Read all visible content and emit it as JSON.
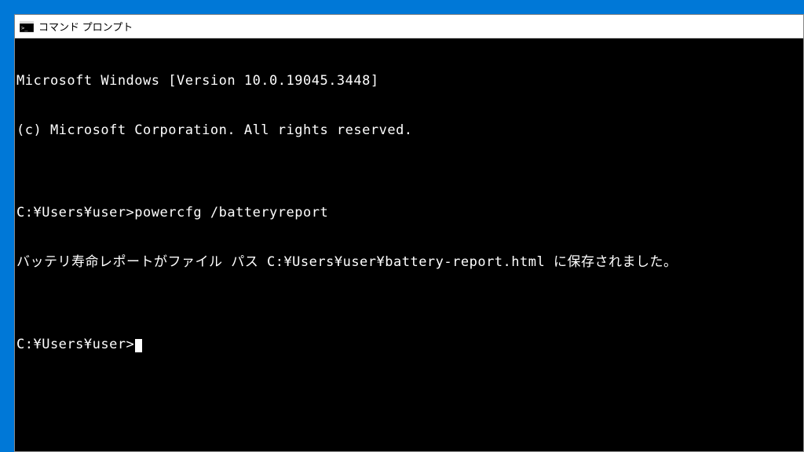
{
  "window": {
    "title": "コマンド プロンプト"
  },
  "terminal": {
    "lines": [
      "Microsoft Windows [Version 10.0.19045.3448]",
      "(c) Microsoft Corporation. All rights reserved.",
      "",
      "C:¥Users¥user>powercfg /batteryreport",
      "バッテリ寿命レポートがファイル パス C:¥Users¥user¥battery-report.html に保存されました。",
      "",
      "C:¥Users¥user>"
    ]
  }
}
